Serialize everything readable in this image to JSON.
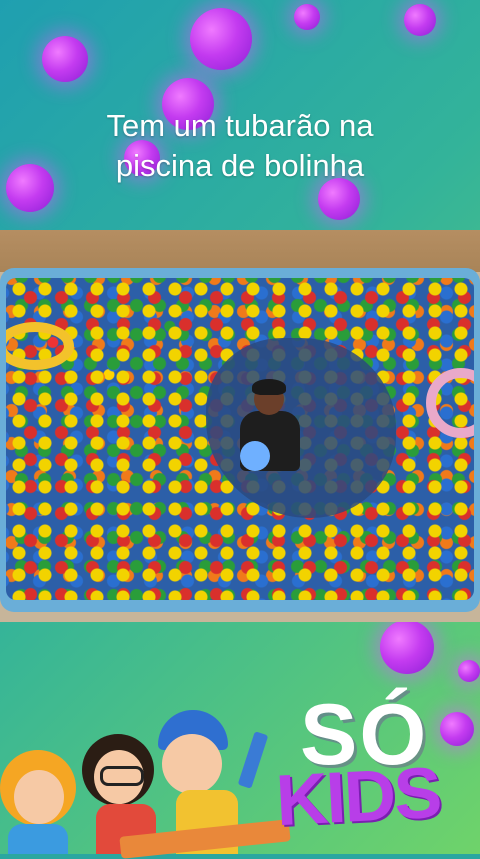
{
  "overlay": {
    "caption_line1": "Tem um tubarão na",
    "caption_line2": "piscina de bolinha"
  },
  "brand": {
    "so_text": "SÓ",
    "kids_text": "KIDS"
  },
  "colors": {
    "caption": "#ffffff",
    "bubble": "#c43bf0",
    "brand_so": "#ffffff",
    "brand_kids": "#b83ee8"
  },
  "icons": [
    "kids-cartoon-illustration",
    "pencil-icon"
  ]
}
